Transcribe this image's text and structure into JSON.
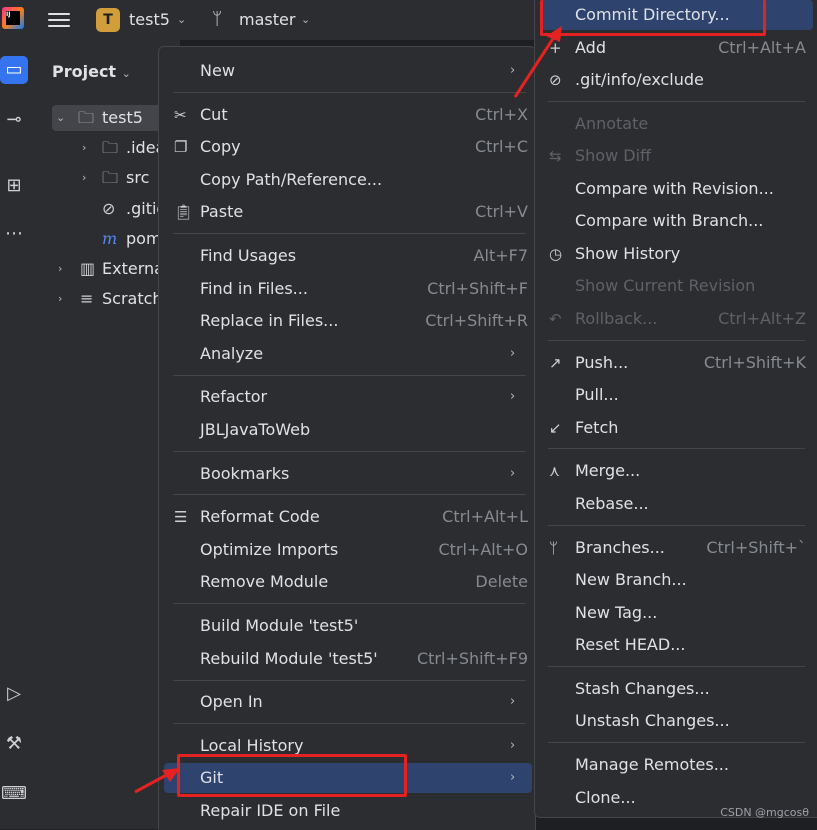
{
  "topbar": {
    "project_badge": "T",
    "project_name": "test5",
    "branch": "master"
  },
  "project_panel": {
    "title": "Project",
    "tree": [
      {
        "label": "test5",
        "icon": "folder-module-icon",
        "selected": true
      },
      {
        "label": ".idea",
        "icon": "folder-icon"
      },
      {
        "label": "src",
        "icon": "folder-icon"
      },
      {
        "label": ".gitig",
        "icon": "ignore-file-icon"
      },
      {
        "label": "pom",
        "icon": "maven-icon"
      },
      {
        "label": "Externa",
        "icon": "library-icon"
      },
      {
        "label": "Scratch",
        "icon": "scratch-icon"
      }
    ]
  },
  "context_menu": {
    "new": "New",
    "cut": "Cut",
    "cut_sc": "Ctrl+X",
    "copy": "Copy",
    "copy_sc": "Ctrl+C",
    "copy_path": "Copy Path/Reference...",
    "paste": "Paste",
    "paste_sc": "Ctrl+V",
    "find_usages": "Find Usages",
    "find_usages_sc": "Alt+F7",
    "find_in_files": "Find in Files...",
    "find_in_files_sc": "Ctrl+Shift+F",
    "replace_in_files": "Replace in Files...",
    "replace_in_files_sc": "Ctrl+Shift+R",
    "analyze": "Analyze",
    "refactor": "Refactor",
    "jbl": "JBLJavaToWeb",
    "bookmarks": "Bookmarks",
    "reformat": "Reformat Code",
    "reformat_sc": "Ctrl+Alt+L",
    "optimize": "Optimize Imports",
    "optimize_sc": "Ctrl+Alt+O",
    "remove_module": "Remove Module",
    "remove_module_sc": "Delete",
    "build_module": "Build Module 'test5'",
    "rebuild_module": "Rebuild Module 'test5'",
    "rebuild_module_sc": "Ctrl+Shift+F9",
    "open_in": "Open In",
    "local_history": "Local History",
    "git": "Git",
    "repair": "Repair IDE on File"
  },
  "git_menu": {
    "commit_dir": "Commit Directory...",
    "add": "Add",
    "add_sc": "Ctrl+Alt+A",
    "exclude": ".git/info/exclude",
    "annotate": "Annotate",
    "show_diff": "Show Diff",
    "compare_rev": "Compare with Revision...",
    "compare_branch": "Compare with Branch...",
    "show_history": "Show History",
    "show_current_rev": "Show Current Revision",
    "rollback": "Rollback...",
    "rollback_sc": "Ctrl+Alt+Z",
    "push": "Push...",
    "push_sc": "Ctrl+Shift+K",
    "pull": "Pull...",
    "fetch": "Fetch",
    "merge": "Merge...",
    "rebase": "Rebase...",
    "branches": "Branches...",
    "branches_sc": "Ctrl+Shift+`",
    "new_branch": "New Branch...",
    "new_tag": "New Tag...",
    "reset_head": "Reset HEAD...",
    "stash": "Stash Changes...",
    "unstash": "Unstash Changes...",
    "manage_remotes": "Manage Remotes...",
    "clone": "Clone..."
  },
  "watermark": "CSDN @mgcosθ",
  "colors": {
    "annotation_red": "#e52222",
    "highlight": "#2e436e",
    "menu_bg": "#2b2d30"
  }
}
